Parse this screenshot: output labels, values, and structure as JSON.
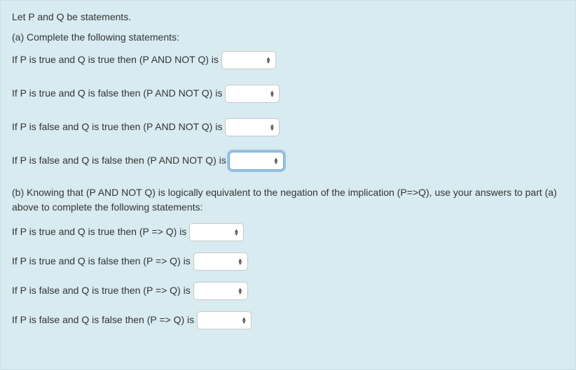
{
  "intro": "Let P and Q be statements.",
  "part_a_heading": "(a) Complete the following statements:",
  "part_a": [
    {
      "text": "If P is true and Q is true then (P AND NOT Q) is",
      "focused": false
    },
    {
      "text": "If P is true and Q is false then (P AND NOT Q) is",
      "focused": false
    },
    {
      "text": "If P is false and Q is true then (P AND NOT Q) is",
      "focused": false
    },
    {
      "text": "If P is false and Q is false then (P AND NOT Q) is",
      "focused": true
    }
  ],
  "part_b_heading": "(b) Knowing that (P AND NOT Q) is logically equivalent to the negation of the implication (P=>Q), use your answers to part (a) above to complete the following statements:",
  "part_b": [
    {
      "text": "If  P  is true and Q is true then (P => Q)  is",
      "focused": false
    },
    {
      "text": "If  P  is true and Q is false then (P => Q)  is",
      "focused": false
    },
    {
      "text": "If  P  is false and Q is true then (P => Q)  is",
      "focused": false
    },
    {
      "text": "If  P  is false and Q is false then (P => Q)  is",
      "focused": false
    }
  ]
}
